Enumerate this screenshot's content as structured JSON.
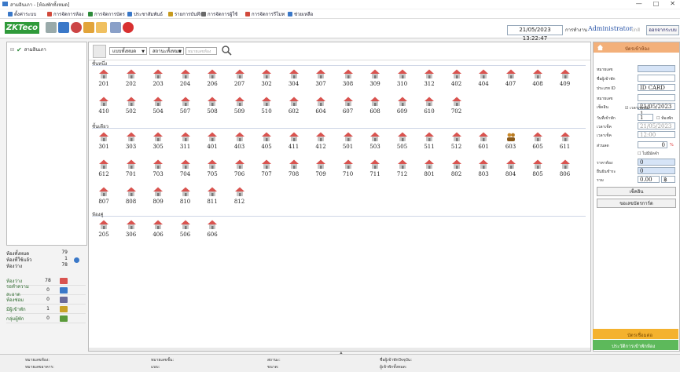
{
  "window": {
    "title": "สามอินเภา - [ห้องพักทั้งหมด]",
    "controls": [
      "—",
      "□",
      "✕"
    ]
  },
  "menu": [
    {
      "label": "ตั้งค่าระบบ",
      "color": "#3a78c8"
    },
    {
      "label": "การจัดการห้อง",
      "color": "#d24a3c"
    },
    {
      "label": "การจัดการบัตร",
      "color": "#2d8b3a"
    },
    {
      "label": "ประชาสัมพันธ์",
      "color": "#3a78c8"
    },
    {
      "label": "รายการบันทึก",
      "color": "#c79a1e"
    },
    {
      "label": "การจัดการผู้ใช้",
      "color": "#6a6a6a"
    },
    {
      "label": "การจัดการรีโมท",
      "color": "#d24a3c"
    },
    {
      "label": "ช่วยเหลือ",
      "color": "#3a78c8"
    }
  ],
  "toolbar": {
    "logo": "ZKTeco",
    "datetime": "21/05/2023 13:22:47",
    "operator_label": "การทำงาน",
    "user": "Administrator",
    "role": "ปกติ",
    "logout": "ออกจากระบบ"
  },
  "tree": {
    "root": "สามอินเภา"
  },
  "stats": [
    {
      "label": "ห้องทั้งหมด",
      "value": "79"
    },
    {
      "label": "ห้องที่ใช้แล้ว",
      "value": "1"
    },
    {
      "label": "ห้องว่าง",
      "value": "78"
    }
  ],
  "legend": [
    {
      "label": "ห้องว่าง",
      "value": "78",
      "color": "#d9534f"
    },
    {
      "label": "รอทำความสะอาด",
      "value": "0",
      "color": "#3a78c8"
    },
    {
      "label": "ห้องซ่อม",
      "value": "0",
      "color": "#6b6b9a"
    },
    {
      "label": "มีผู้เข้าพัก",
      "value": "1",
      "color": "#c9a227"
    },
    {
      "label": "กลุ่มผู้พัก",
      "value": "0",
      "color": "#5a9a3a"
    }
  ],
  "filters": {
    "building": "แบบทั้งหมด",
    "status": "สถานะทั้งหมด",
    "search_placeholder": "หมายเลขห้อง"
  },
  "sections": [
    {
      "name": "ชั้นหนึ่ง",
      "rows": [
        [
          "201",
          "202",
          "203",
          "204",
          "206",
          "207",
          "302",
          "304",
          "307",
          "308",
          "309",
          "310",
          "312",
          "402",
          "404",
          "407",
          "408",
          "409"
        ],
        [
          "410",
          "502",
          "504",
          "507",
          "508",
          "509",
          "510",
          "602",
          "604",
          "607",
          "608",
          "609",
          "610",
          "702"
        ]
      ]
    },
    {
      "name": "ชั้นเดียว",
      "rows": [
        [
          "301",
          "303",
          "305",
          "311",
          "401",
          "403",
          "405",
          "411",
          "412",
          "501",
          "503",
          "505",
          "511",
          "512",
          "601",
          "603",
          "605",
          "611"
        ],
        [
          "612",
          "701",
          "703",
          "704",
          "705",
          "706",
          "707",
          "708",
          "709",
          "710",
          "711",
          "712",
          "801",
          "802",
          "803",
          "804",
          "805",
          "806"
        ],
        [
          "807",
          "808",
          "809",
          "810",
          "811",
          "812"
        ]
      ]
    },
    {
      "name": "ห้องคู่",
      "rows": [
        [
          "205",
          "306",
          "406",
          "506",
          "606"
        ]
      ]
    }
  ],
  "occupied_rooms": [
    "603"
  ],
  "right_panel": {
    "header": "บัตรเข้าห้อง",
    "fields": [
      {
        "label": "หมายเลข",
        "value": "",
        "style": "blue"
      },
      {
        "label": "ชื่อผู้เข้าพัก",
        "value": "",
        "style": ""
      },
      {
        "label": "ประเภท ID",
        "value": "ID CARD",
        "style": ""
      },
      {
        "label": "หมายเลข",
        "value": "",
        "style": ""
      },
      {
        "label": "เช็คอิน",
        "value": "21/05/2023 1",
        "style": ""
      }
    ],
    "checkbox_time": "เวลาเช็คอิน",
    "days_label": "วันที่เข้าพัก",
    "days_value": "1",
    "days_check": "ห้องพัก",
    "checkout_label": "เวลาเช็ค",
    "checkout_date": "21/05/2023",
    "time_label": "เวลาเช็ค",
    "time_value": "12:00",
    "discount_label": "ส่วนลด",
    "discount_value": "0",
    "discount_unit": "%",
    "deposit_check": "ไม่มีมัดจำ",
    "price_label": "ราคาห้อง",
    "price_value": "0",
    "paid_label": "ยืนยันชำระ",
    "paid_value": "0",
    "total_label": "รวม",
    "total_value": "0.00",
    "currency": "฿",
    "checkin_btn": "เช็คอิน",
    "card_btn": "ขอเลขบัตรการ์ด",
    "orange_bar": "บัตรเชื่อมต่อ",
    "green_bar": "ประวัติการเข้าพักห้อง"
  },
  "statusbar": [
    {
      "label": "หมายเลขห้อง:",
      "sub": "หมายเลขอาคาร:"
    },
    {
      "label": "หมายเลขชั้น:",
      "sub": "แบบ:"
    },
    {
      "label": "สถานะ:",
      "sub": "ขนาด:"
    },
    {
      "label": "ชื่อผู้เข้าพักปัจจุบัน:",
      "sub": "ผู้เข้าพักทั้งหมด:"
    }
  ]
}
